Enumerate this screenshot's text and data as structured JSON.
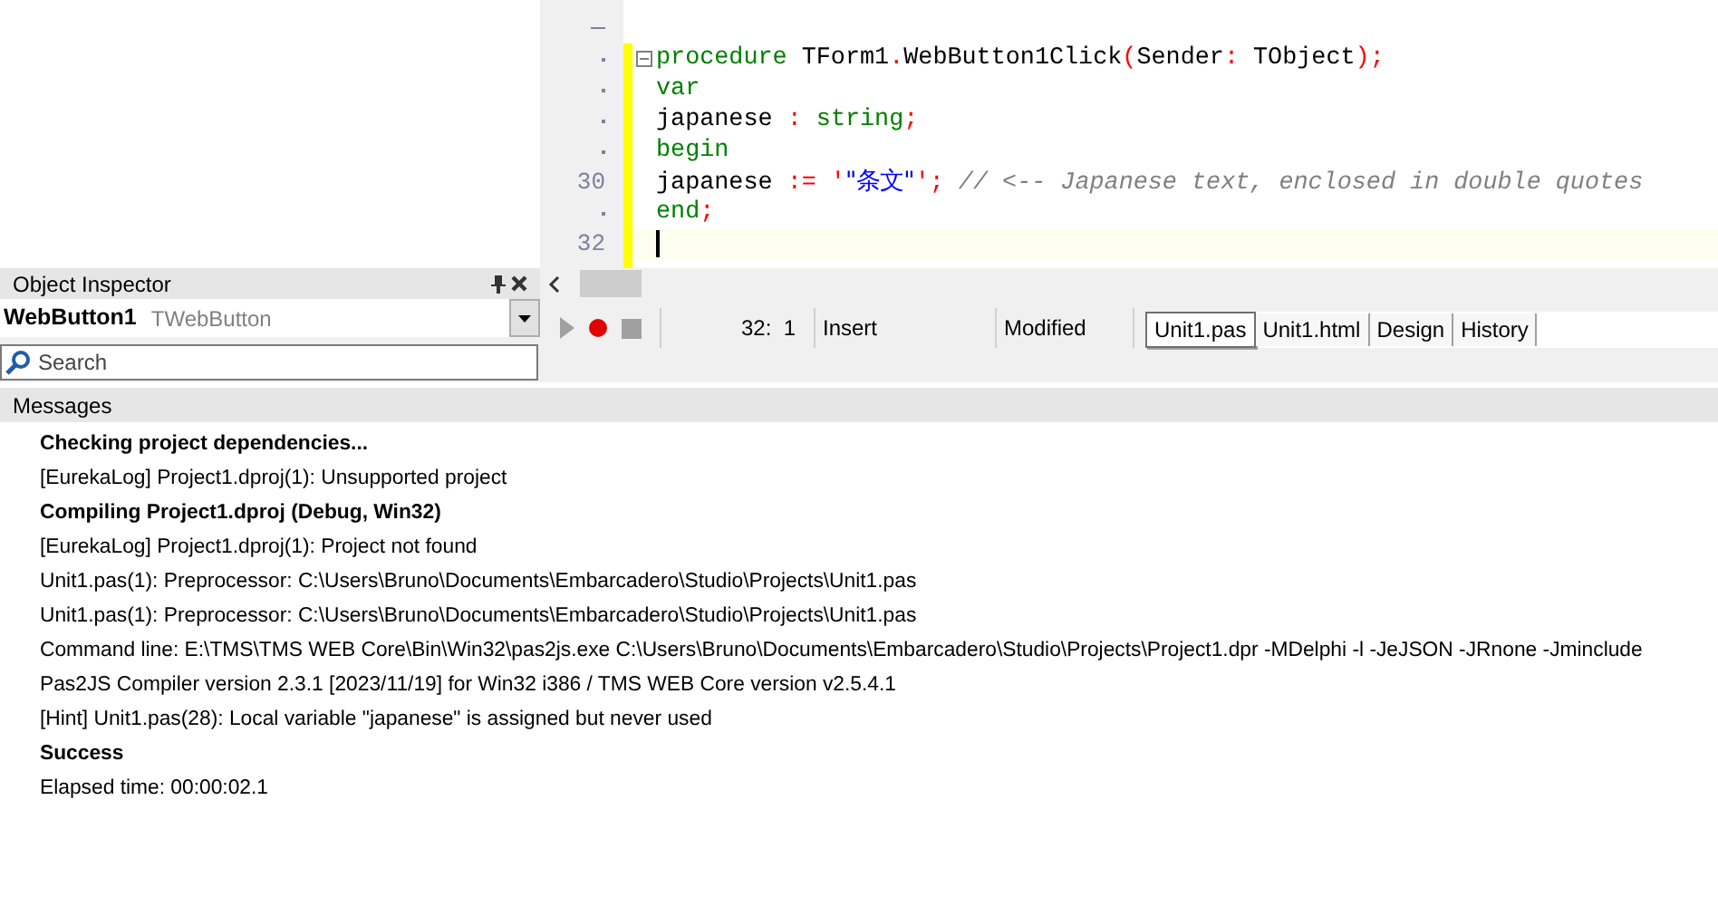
{
  "editor": {
    "lines": [
      {
        "fold": true,
        "current": false,
        "tokens": [
          {
            "kind": "keyword",
            "text": "procedure"
          },
          {
            "kind": "ident",
            "text": " TForm1"
          },
          {
            "kind": "symbol",
            "text": "."
          },
          {
            "kind": "ident",
            "text": "WebButton1Click"
          },
          {
            "kind": "symbol",
            "text": "("
          },
          {
            "kind": "ident",
            "text": "Sender"
          },
          {
            "kind": "symbol",
            "text": ":"
          },
          {
            "kind": "ident",
            "text": " TObject"
          },
          {
            "kind": "symbol",
            "text": ");"
          }
        ]
      },
      {
        "fold": false,
        "current": false,
        "tokens": [
          {
            "kind": "keyword",
            "text": "var"
          }
        ]
      },
      {
        "fold": false,
        "current": false,
        "tokens": [
          {
            "kind": "ident",
            "text": "japanese "
          },
          {
            "kind": "symbol",
            "text": ":"
          },
          {
            "kind": "keyword",
            "text": " string"
          },
          {
            "kind": "symbol",
            "text": ";"
          }
        ]
      },
      {
        "fold": false,
        "current": false,
        "tokens": [
          {
            "kind": "keyword",
            "text": "begin"
          }
        ]
      },
      {
        "number": "30",
        "fold": false,
        "current": false,
        "tokens": [
          {
            "kind": "ident",
            "text": "japanese "
          },
          {
            "kind": "symbol",
            "text": ":= '"
          },
          {
            "kind": "string",
            "text": "\"条文\""
          },
          {
            "kind": "symbol",
            "text": "';"
          },
          {
            "kind": "comment",
            "text": " // <-- Japanese text, enclosed in double quotes"
          }
        ]
      },
      {
        "fold": false,
        "current": false,
        "tokens": [
          {
            "kind": "keyword",
            "text": "end"
          },
          {
            "kind": "symbol",
            "text": ";"
          }
        ]
      },
      {
        "number": "32",
        "fold": false,
        "current": true
      }
    ]
  },
  "object_inspector": {
    "title": "Object Inspector",
    "component": "WebButton1",
    "type": "TWebButton",
    "search": {
      "placeholder": "Search"
    }
  },
  "status_bar": {
    "position": "32:  1",
    "mode": "Insert",
    "state": "Modified"
  },
  "tabs": [
    {
      "label": "Unit1.pas",
      "selected": true
    },
    {
      "label": "Unit1.html",
      "selected": false
    },
    {
      "label": "Design",
      "selected": false
    },
    {
      "label": "History",
      "selected": false
    }
  ],
  "messages": {
    "title": "Messages",
    "items": [
      {
        "text": "Checking project dependencies...",
        "bold": true
      },
      {
        "text": "[EurekaLog] Project1.dproj(1): Unsupported project",
        "bold": false
      },
      {
        "text": "Compiling Project1.dproj (Debug, Win32)",
        "bold": true
      },
      {
        "text": "[EurekaLog] Project1.dproj(1): Project not found",
        "bold": false
      },
      {
        "text": "Unit1.pas(1): Preprocessor: C:\\Users\\Bruno\\Documents\\Embarcadero\\Studio\\Projects\\Unit1.pas",
        "bold": false
      },
      {
        "text": "Unit1.pas(1): Preprocessor: C:\\Users\\Bruno\\Documents\\Embarcadero\\Studio\\Projects\\Unit1.pas",
        "bold": false
      },
      {
        "text": "Command line: E:\\TMS\\TMS WEB Core\\Bin\\Win32\\pas2js.exe C:\\Users\\Bruno\\Documents\\Embarcadero\\Studio\\Projects\\Project1.dpr -MDelphi -l -JeJSON -JRnone -Jminclude",
        "bold": false
      },
      {
        "text": "Pas2JS Compiler version 2.3.1 [2023/11/19] for Win32 i386 / TMS WEB Core version v2.5.4.1",
        "bold": false
      },
      {
        "text": "[Hint] Unit1.pas(28): Local variable \"japanese\" is assigned but never used",
        "bold": false
      },
      {
        "text": "Success",
        "bold": true
      },
      {
        "text": "Elapsed time: 00:00:02.1",
        "bold": false
      }
    ]
  }
}
